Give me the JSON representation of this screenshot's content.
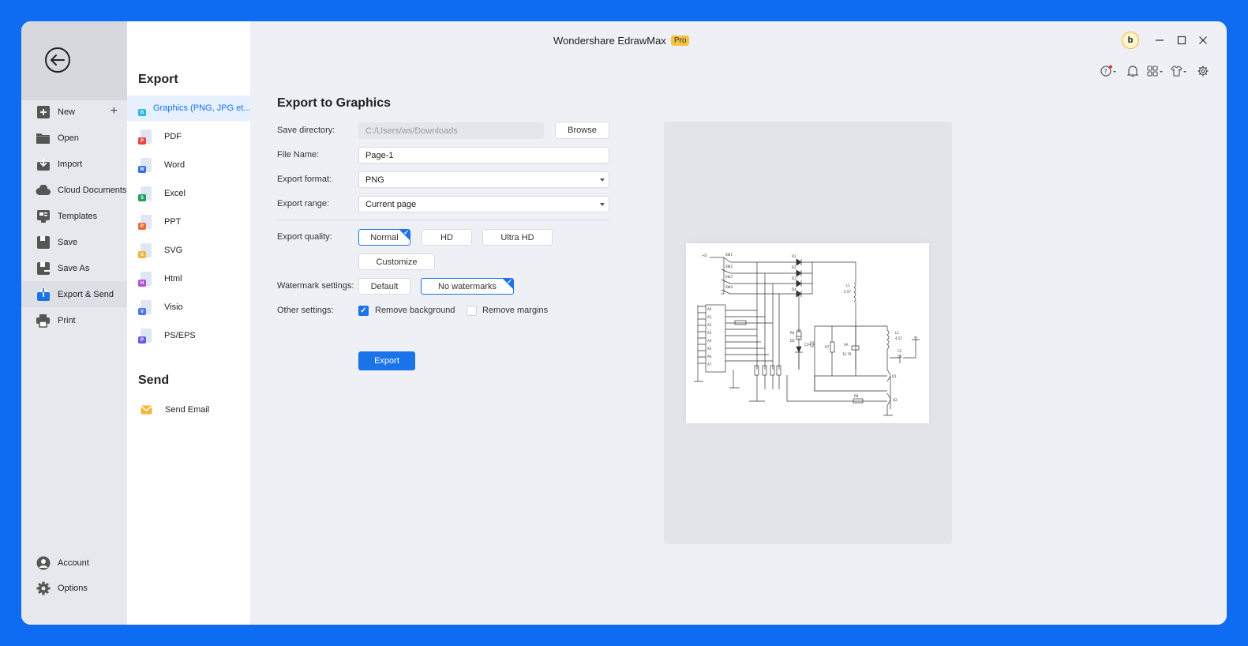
{
  "app": {
    "title": "Wondershare EdrawMax",
    "badge": "Pro",
    "avatar_letter": "b"
  },
  "nav": {
    "items": [
      {
        "label": "New",
        "icon": "plus-square-icon"
      },
      {
        "label": "Open",
        "icon": "folder-icon"
      },
      {
        "label": "Import",
        "icon": "import-icon"
      },
      {
        "label": "Cloud Documents",
        "icon": "cloud-icon"
      },
      {
        "label": "Templates",
        "icon": "templates-icon"
      },
      {
        "label": "Save",
        "icon": "save-icon"
      },
      {
        "label": "Save As",
        "icon": "save-as-icon"
      },
      {
        "label": "Export & Send",
        "icon": "export-icon",
        "active": true
      },
      {
        "label": "Print",
        "icon": "print-icon"
      }
    ],
    "bottom": [
      {
        "label": "Account",
        "icon": "account-icon"
      },
      {
        "label": "Options",
        "icon": "gear-icon"
      }
    ]
  },
  "export_col": {
    "title": "Export",
    "items": [
      {
        "label": "Graphics (PNG, JPG et...",
        "color": "#2bb6e8",
        "letter": "G"
      },
      {
        "label": "PDF",
        "color": "#e8453c",
        "letter": "P"
      },
      {
        "label": "Word",
        "color": "#2f6fe0",
        "letter": "W"
      },
      {
        "label": "Excel",
        "color": "#1e9e5a",
        "letter": "S"
      },
      {
        "label": "PPT",
        "color": "#f06a35",
        "letter": "P"
      },
      {
        "label": "SVG",
        "color": "#f3b33d",
        "letter": "S"
      },
      {
        "label": "Html",
        "color": "#b14fd8",
        "letter": "H"
      },
      {
        "label": "Visio",
        "color": "#4a78e8",
        "letter": "V"
      },
      {
        "label": "PS/EPS",
        "color": "#6a5ae0",
        "letter": "P"
      }
    ],
    "send_title": "Send",
    "send_items": [
      {
        "label": "Send Email"
      }
    ]
  },
  "form": {
    "title": "Export to Graphics",
    "save_dir_label": "Save directory:",
    "save_dir_value": "C:/Users/ws/Downloads",
    "browse_label": "Browse",
    "file_name_label": "File Name:",
    "file_name_value": "Page-1",
    "format_label": "Export format:",
    "format_value": "PNG",
    "range_label": "Export range:",
    "range_value": "Current page",
    "quality_label": "Export quality:",
    "quality_options": [
      "Normal",
      "HD",
      "Ultra HD"
    ],
    "quality_selected": "Normal",
    "customize_label": "Customize",
    "watermark_label": "Watermark settings:",
    "watermark_options": [
      "Default",
      "No watermarks"
    ],
    "watermark_selected": "No watermarks",
    "other_label": "Other settings:",
    "remove_bg_label": "Remove background",
    "remove_bg_checked": true,
    "remove_margins_label": "Remove margins",
    "remove_margins_checked": false,
    "export_button": "Export"
  },
  "colors": {
    "accent": "#1a73e8",
    "frame": "#0e6cf2",
    "pro_badge": "#f5c242"
  }
}
